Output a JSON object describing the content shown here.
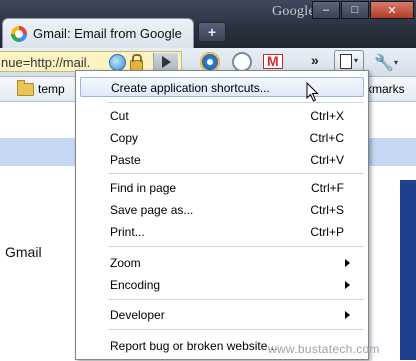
{
  "window": {
    "brand": "Google",
    "minimize": "–",
    "maximize": "□",
    "close": "✕"
  },
  "tab": {
    "title": "Gmail: Email from Google",
    "new_tab": "+"
  },
  "omnibox": {
    "text": "nue=http://mail."
  },
  "toolbar": {
    "overflow": "»",
    "page_chevron": "▾",
    "wrench_chevron": "▾",
    "wrench": "🔧"
  },
  "bookmarks": {
    "folder": "temp",
    "other": "kmarks"
  },
  "page": {
    "gmail_label": "Gmail"
  },
  "menu": {
    "items": [
      {
        "label": "Create application shortcuts...",
        "shortcut": ""
      },
      {
        "label": "Cut",
        "shortcut": "Ctrl+X"
      },
      {
        "label": "Copy",
        "shortcut": "Ctrl+C"
      },
      {
        "label": "Paste",
        "shortcut": "Ctrl+V"
      },
      {
        "label": "Find in page",
        "shortcut": "Ctrl+F"
      },
      {
        "label": "Save page as...",
        "shortcut": "Ctrl+S"
      },
      {
        "label": "Print...",
        "shortcut": "Ctrl+P"
      },
      {
        "label": "Zoom",
        "shortcut": ""
      },
      {
        "label": "Encoding",
        "shortcut": ""
      },
      {
        "label": "Developer",
        "shortcut": ""
      },
      {
        "label": "Report bug or broken website...",
        "shortcut": ""
      }
    ]
  },
  "watermark": "www.bustatech.com"
}
